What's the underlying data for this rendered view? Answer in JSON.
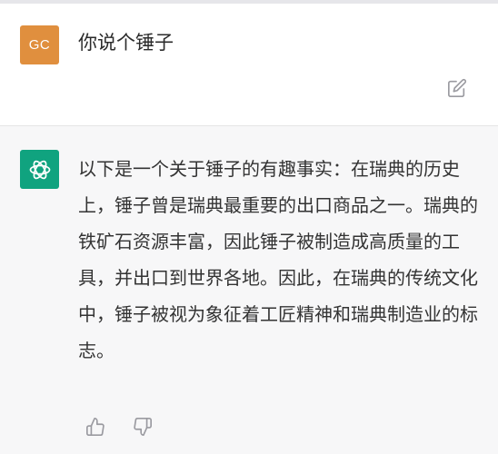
{
  "user_message": {
    "avatar_initials": "GC",
    "text": "你说个锤子"
  },
  "assistant_message": {
    "text": "以下是一个关于锤子的有趣事实：在瑞典的历史上，锤子曾是瑞典最重要的出口商品之一。瑞典的铁矿石资源丰富，因此锤子被制造成高质量的工具，并出口到世界各地。因此，在瑞典的传统文化中，锤子被视为象征着工匠精神和瑞典制造业的标志。"
  },
  "icons": {
    "edit": "edit-icon",
    "assistant_logo": "openai-logo-icon",
    "thumbs_up": "thumbs-up-icon",
    "thumbs_down": "thumbs-down-icon"
  },
  "colors": {
    "user_avatar": "#e08f3e",
    "assistant_avatar": "#10a37f",
    "user_bg": "#ffffff",
    "assistant_bg": "#f7f7f8"
  }
}
